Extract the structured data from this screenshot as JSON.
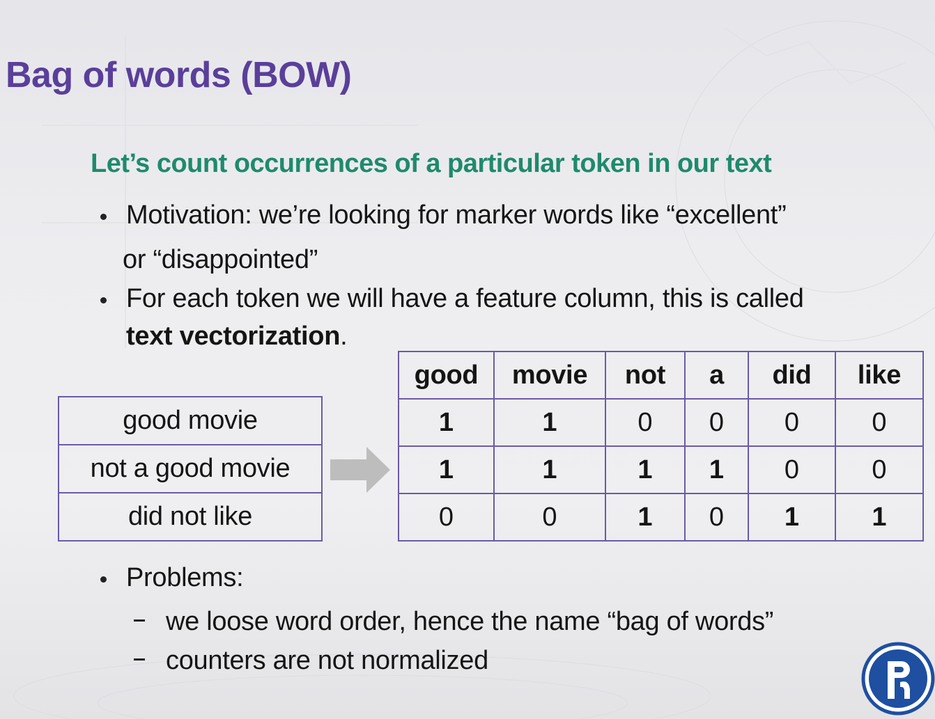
{
  "slide": {
    "title": "Bag of words (BOW)",
    "subtitle": "Let’s count occurrences of a particular token in our text",
    "bullet1_line1": "Motivation: we’re looking for marker words like “excellent”",
    "bullet1_line2": "or “disappointed”",
    "bullet2_line1": "For each token we will have a feature column, this is called",
    "bullet2_bold": "text vectorization",
    "bullet2_end": ".",
    "bullet3": "Problems:",
    "sub1": "we loose word order, hence the name “bag of words”",
    "sub2": "counters are not normalized"
  },
  "texts": [
    "good movie",
    "not a good movie",
    "did not like"
  ],
  "vector_table": {
    "headers": [
      "good",
      "movie",
      "not",
      "a",
      "did",
      "like"
    ],
    "rows": [
      [
        "1",
        "1",
        "0",
        "0",
        "0",
        "0"
      ],
      [
        "1",
        "1",
        "1",
        "1",
        "0",
        "0"
      ],
      [
        "0",
        "0",
        "1",
        "0",
        "1",
        "1"
      ]
    ]
  },
  "colors": {
    "title": "#5a3f9a",
    "subtitle": "#1f8a6c",
    "table_border": "#6a5aa8",
    "arrow": "#bdbdbd",
    "logo": "#1e4fa0"
  },
  "icons": {
    "transform_arrow": "arrow-right-icon",
    "logo": "hse-logo-icon"
  }
}
